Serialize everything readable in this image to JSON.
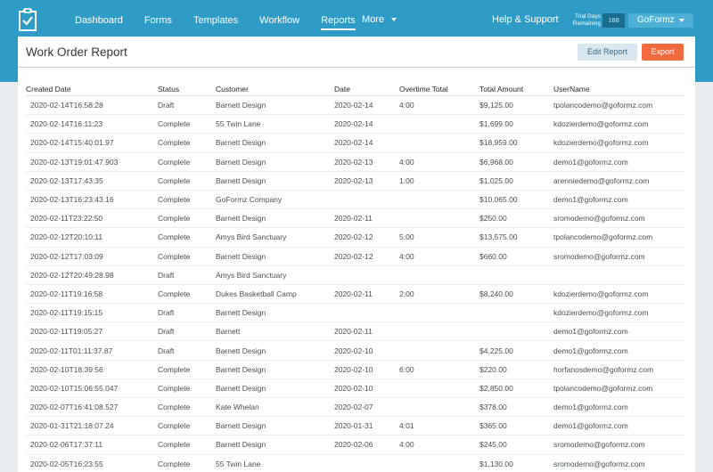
{
  "nav": {
    "items": [
      "Dashboard",
      "Forms",
      "Templates",
      "Workflow",
      "Reports"
    ],
    "more": "More",
    "active": "Reports"
  },
  "header": {
    "help": "Help & Support",
    "trial_label_1": "Trial Days",
    "trial_label_2": "Remaining",
    "trial_days": "188",
    "account": "GoFormz"
  },
  "report": {
    "title": "Work Order Report",
    "edit_label": "Edit Report",
    "export_label": "Export"
  },
  "colors": {
    "topbar": "#2f9cc7",
    "export": "#f26a3f",
    "edit": "#d9e7f0"
  },
  "table": {
    "columns": [
      "Created Date",
      "Status",
      "Customer",
      "Date",
      "Overtime Total",
      "Total Amount",
      "UserName"
    ],
    "rows": [
      [
        "2020-02-14T16:58:28",
        "Draft",
        "Barnett Design",
        "2020-02-14",
        "4:00",
        "$9,125.00",
        "tpolancodemo@goformz.com"
      ],
      [
        "2020-02-14T16:11:23",
        "Complete",
        "55 Twin Lane",
        "2020-02-14",
        "",
        "$1,699.00",
        "kdozierdemo@goformz.com"
      ],
      [
        "2020-02-14T15:40:01.97",
        "Complete",
        "Barnett Design",
        "2020-02-14",
        "",
        "$18,959.00",
        "kdozierdemo@goformz.com"
      ],
      [
        "2020-02-13T19:01:47.903",
        "Complete",
        "Barnett Design",
        "2020-02-13",
        "4:00",
        "$6,968.00",
        "demo1@goformz.com"
      ],
      [
        "2020-02-13T17:43:35",
        "Complete",
        "Barnett Design",
        "2020-02-13",
        "1:00",
        "$1,025.00",
        "arenniedemo@goformz.com"
      ],
      [
        "2020-02-13T16:23:43.16",
        "Complete",
        "GoFormz Company",
        "",
        "",
        "$10,065.00",
        "demo1@goformz.com"
      ],
      [
        "2020-02-11T23:22:50",
        "Complete",
        "Barnett Design",
        "2020-02-11",
        "",
        "$250.00",
        "sromodemo@goformz.com"
      ],
      [
        "2020-02-12T20:10:11",
        "Complete",
        "Amys Bird Sanctuary",
        "2020-02-12",
        "5:00",
        "$13,575.00",
        "tpolancodemo@goformz.com"
      ],
      [
        "2020-02-12T17:03:09",
        "Complete",
        "Barnett Design",
        "2020-02-12",
        "4:00",
        "$660.00",
        "sromodemo@goformz.com"
      ],
      [
        "2020-02-12T20:49:28.98",
        "Draft",
        "Amys Bird Sanctuary",
        "",
        "",
        "",
        ""
      ],
      [
        "2020-02-11T19:16:58",
        "Complete",
        "Dukes Basketball Camp",
        "2020-02-11",
        "2:00",
        "$8,240.00",
        "kdozierdemo@goformz.com"
      ],
      [
        "2020-02-11T19:15:15",
        "Draft",
        "Barnett Design",
        "",
        "",
        "",
        "kdozierdemo@goformz.com"
      ],
      [
        "2020-02-11T19:05:27",
        "Draft",
        "Barnett",
        "2020-02-11",
        "",
        "",
        "demo1@goformz.com"
      ],
      [
        "2020-02-11T01:11:37.87",
        "Draft",
        "Barnett Design",
        "2020-02-10",
        "",
        "$4,225.00",
        "demo1@goformz.com"
      ],
      [
        "2020-02-10T18:39:56",
        "Complete",
        "Barnett Design",
        "2020-02-10",
        "6:00",
        "$220.00",
        "horfanosdemo@goformz.com"
      ],
      [
        "2020-02-10T15:06:55.047",
        "Complete",
        "Barnett Design",
        "2020-02-10",
        "",
        "$2,850.00",
        "tpolancodemo@goformz.com"
      ],
      [
        "2020-02-07T16:41:08.527",
        "Complete",
        "Kate Whelan",
        "2020-02-07",
        "",
        "$378.00",
        "demo1@goformz.com"
      ],
      [
        "2020-01-31T21:18:07.24",
        "Complete",
        "Barnett Design",
        "2020-01-31",
        "4:01",
        "$365.00",
        "demo1@goformz.com"
      ],
      [
        "2020-02-06T17:37:11",
        "Complete",
        "Barnett Design",
        "2020-02-06",
        "4:00",
        "$245.00",
        "sromodemo@goformz.com"
      ],
      [
        "2020-02-05T16:23:55",
        "Complete",
        "55 Twin Lane",
        "",
        "",
        "$1,130.00",
        "sromodemo@goformz.com"
      ]
    ]
  }
}
